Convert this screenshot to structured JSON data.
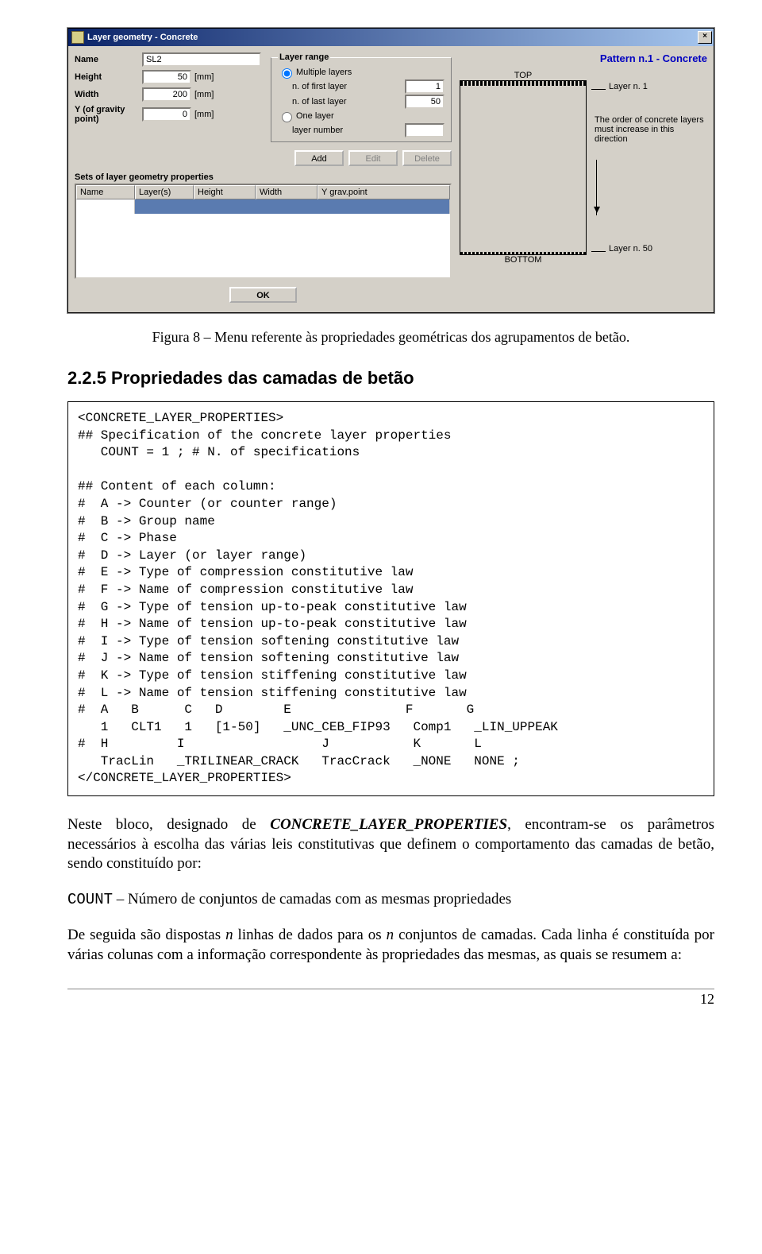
{
  "dialog": {
    "title": "Layer geometry - Concrete",
    "name_label": "Name",
    "name_value": "SL2",
    "height_label": "Height",
    "height_value": "50",
    "height_unit": "[mm]",
    "width_label": "Width",
    "width_value": "200",
    "width_unit": "[mm]",
    "ygrav_label": "Y (of gravity point)",
    "ygrav_value": "0",
    "ygrav_unit": "[mm]",
    "layer_range": {
      "legend": "Layer range",
      "multiple_label": "Multiple layers",
      "first_label": "n. of first layer",
      "first_value": "1",
      "last_label": "n. of last layer",
      "last_value": "50",
      "one_label": "One layer",
      "layer_number_label": "layer number",
      "layer_number_value": ""
    },
    "buttons": {
      "add": "Add",
      "edit": "Edit",
      "delete": "Delete",
      "ok": "OK"
    },
    "sets_label": "Sets of layer geometry properties",
    "columns": {
      "c1": "Name",
      "c2": "Layer(s)",
      "c3": "Height",
      "c4": "Width",
      "c5": "Y grav.point"
    },
    "pattern_title": "Pattern n.1 - Concrete",
    "diagram": {
      "top": "TOP",
      "bottom": "BOTTOM",
      "layer1": "Layer n. 1",
      "layer50": "Layer n. 50",
      "order_text": "The order of concrete layers must increase in this direction"
    }
  },
  "caption": "Figura 8 – Menu referente às propriedades geométricas dos agrupamentos de betão.",
  "section_heading": "2.2.5 Propriedades das camadas de betão",
  "code": "<CONCRETE_LAYER_PROPERTIES>\n## Specification of the concrete layer properties\n   COUNT = 1 ; # N. of specifications\n\n## Content of each column:\n#  A -> Counter (or counter range)\n#  B -> Group name\n#  C -> Phase\n#  D -> Layer (or layer range)\n#  E -> Type of compression constitutive law\n#  F -> Name of compression constitutive law\n#  G -> Type of tension up-to-peak constitutive law\n#  H -> Name of tension up-to-peak constitutive law\n#  I -> Type of tension softening constitutive law\n#  J -> Name of tension softening constitutive law\n#  K -> Type of tension stiffening constitutive law\n#  L -> Name of tension stiffening constitutive law\n#  A   B      C   D        E               F       G\n   1   CLT1   1   [1-50]   _UNC_CEB_FIP93   Comp1   _LIN_UPPEAK\n#  H         I                  J           K       L\n   TracLin   _TRILINEAR_CRACK   TracCrack   _NONE   NONE ;\n</CONCRETE_LAYER_PROPERTIES>",
  "para1_a": "Neste bloco, designado de ",
  "para1_b": "CONCRETE_LAYER_PROPERTIES",
  "para1_c": ", encontram-se os parâmetros necessários à escolha das várias leis constitutivas que definem o comportamento das camadas de betão, sendo constituído por:",
  "para2_a": "COUNT",
  "para2_b": " – Número de conjuntos de camadas com as mesmas propriedades",
  "para3_a": "De seguida são dispostas ",
  "para3_n1": "n",
  "para3_b": " linhas de dados para os ",
  "para3_n2": "n",
  "para3_c": " conjuntos de camadas. Cada linha é constituída por várias colunas com a informação correspondente às propriedades das mesmas, as quais se resumem a:",
  "page_number": "12"
}
